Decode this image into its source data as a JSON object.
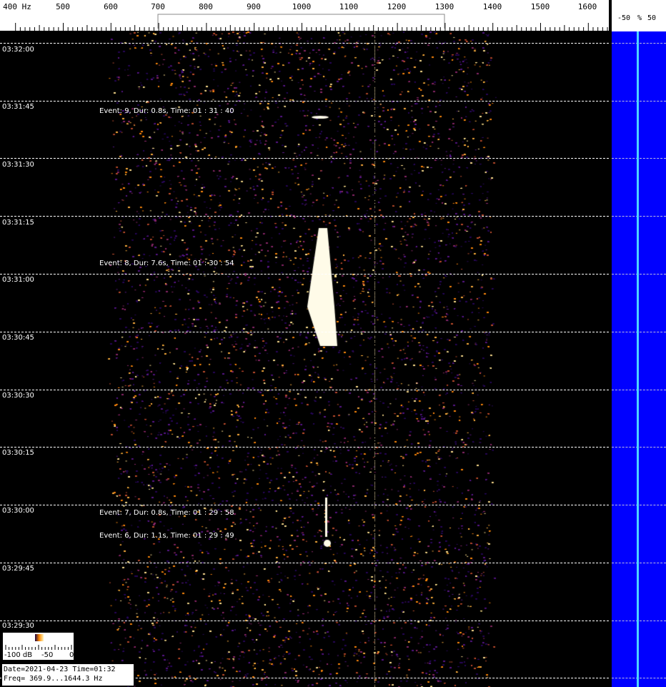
{
  "freq_axis": {
    "unit_label": "400 Hz",
    "labels": [
      "500",
      "600",
      "700",
      "800",
      "900",
      "1000",
      "1100",
      "1200",
      "1300",
      "1400",
      "1500",
      "1600"
    ]
  },
  "time_labels": [
    "03:32:00",
    "03:31:45",
    "03:31:30",
    "03:31:15",
    "03:31:00",
    "03:30:45",
    "03:30:30",
    "03:30:15",
    "03:30:00",
    "03:29:45",
    "03:29:30"
  ],
  "events": [
    {
      "text": "Event: 9, Dur: 0.8s, Time: 01 : 31 : 40"
    },
    {
      "text": "Event: 8, Dur: 7.6s, Time: 01 : 30 : 54"
    },
    {
      "text": "Event: 7, Dur: 0.8s, Time: 01 : 29 : 58"
    },
    {
      "text": "Event: 6, Dur: 1.1s, Time: 01 : 29 : 49"
    }
  ],
  "right_panel": {
    "label_left": "-50",
    "label_mid": "%",
    "label_right": "50"
  },
  "legend": {
    "min": "-100 dB",
    "mid": "-50",
    "max": "0"
  },
  "info": {
    "line1": "Date=2021-04-23 Time=01:32",
    "line2": "Freq= 369.9...1644.3 Hz"
  },
  "colors": {
    "background": "#000000",
    "signal_low": "#3a0a7a",
    "signal_mid": "#ff8a10",
    "signal_high": "#fff8c8",
    "panel_blue": "#0000ff",
    "trace": "#4fd4ff"
  }
}
